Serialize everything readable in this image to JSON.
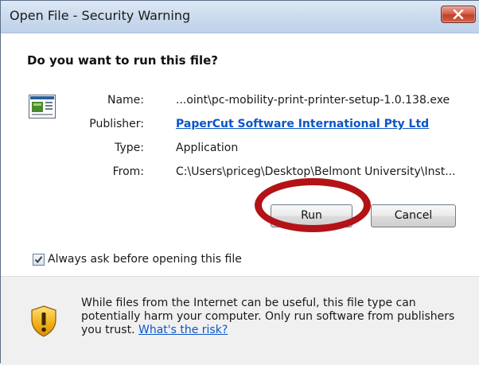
{
  "dialog": {
    "title": "Open File - Security Warning",
    "heading": "Do you want to run this file?"
  },
  "file_info": {
    "name_label": "Name:",
    "name_value": "...oint\\pc-mobility-print-printer-setup-1.0.138.exe",
    "publisher_label": "Publisher:",
    "publisher_value": "PaperCut Software International Pty Ltd",
    "type_label": "Type:",
    "type_value": "Application",
    "from_label": "From:",
    "from_value": "C:\\Users\\priceg\\Desktop\\Belmont University\\Inst..."
  },
  "buttons": {
    "run": "Run",
    "cancel": "Cancel"
  },
  "checkbox": {
    "label": "Always ask before opening this file",
    "checked": true
  },
  "warning": {
    "text": "While files from the Internet can be useful, this file type can potentially harm your computer. Only run software from publishers you trust.",
    "link": "What's the risk?"
  },
  "icons": {
    "close": "close-icon",
    "file": "application-file-icon",
    "shield": "shield-warning-icon",
    "check": "checkmark-icon"
  },
  "colors": {
    "link": "#0b55c8",
    "highlight_ring": "#b31217",
    "close_button": "#c94a34"
  }
}
